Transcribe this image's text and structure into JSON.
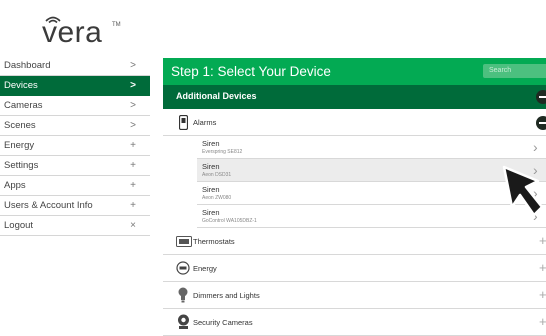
{
  "logo": {
    "text": "vera",
    "tm": "TM"
  },
  "nav": [
    {
      "label": "Dashboard",
      "indicator": ">"
    },
    {
      "label": "Devices",
      "indicator": ">",
      "active": true
    },
    {
      "label": "Cameras",
      "indicator": ">"
    },
    {
      "label": "Scenes",
      "indicator": ">"
    },
    {
      "label": "Energy",
      "indicator": "+"
    },
    {
      "label": "Settings",
      "indicator": "+"
    },
    {
      "label": "Apps",
      "indicator": "+"
    },
    {
      "label": "Users & Account Info",
      "indicator": "+"
    },
    {
      "label": "Logout",
      "indicator": "×"
    }
  ],
  "header": {
    "title": "Step 1: Select Your Device",
    "search_placeholder": "Search"
  },
  "section": {
    "title": "Additional Devices"
  },
  "categories": {
    "alarms": "Alarms",
    "thermostats": "Thermostats",
    "energy": "Energy",
    "dimmers": "Dimmers and Lights",
    "cameras": "Security Cameras"
  },
  "devices": [
    {
      "name": "Siren",
      "model": "Everspring SE812"
    },
    {
      "name": "Siren",
      "model": "Aeon DSD31"
    },
    {
      "name": "Siren",
      "model": "Aeon ZW080"
    },
    {
      "name": "Siren",
      "model": "GoControl WA105DBZ-1"
    }
  ],
  "colors": {
    "brand_green": "#03aa53",
    "dark_green": "#006b3a"
  }
}
